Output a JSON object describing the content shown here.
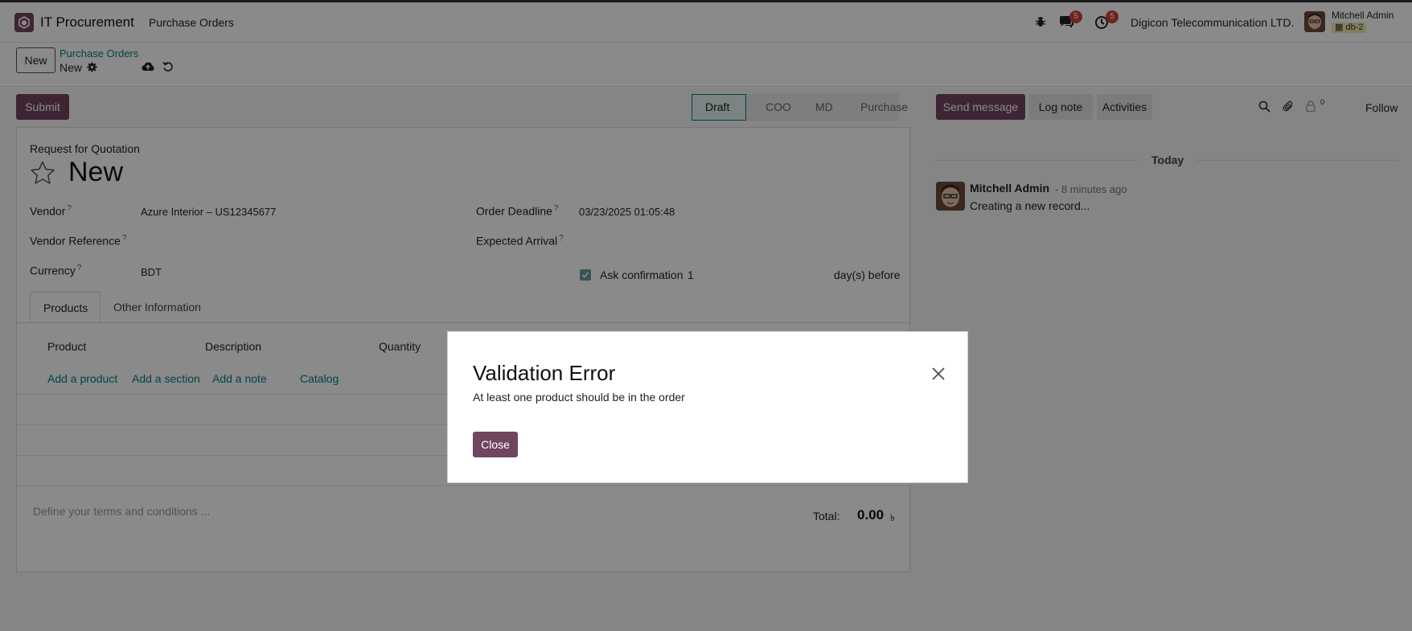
{
  "navbar": {
    "app_name": "IT Procurement",
    "menu": "Purchase Orders",
    "chat_badge": "5",
    "activity_badge": "5",
    "company": "Digicon Telecommunication LTD.",
    "user_name": "Mitchell Admin",
    "db_name": "db-2"
  },
  "control": {
    "new_label": "New",
    "breadcrumb_parent": "Purchase Orders",
    "breadcrumb_current": "New"
  },
  "form": {
    "submit_label": "Submit",
    "stages": [
      "Draft",
      "COO",
      "MD",
      "Purchase"
    ],
    "active_stage": "Draft",
    "subtitle": "Request for Quotation",
    "title": "New",
    "vendor_label": "Vendor",
    "vendor_value": "Azure Interior – US12345677",
    "vendor_ref_label": "Vendor Reference",
    "currency_label": "Currency",
    "currency_value": "BDT",
    "order_deadline_label": "Order Deadline",
    "order_deadline_value": "03/23/2025 01:05:48",
    "expected_arrival_label": "Expected Arrival",
    "ask_confirmation_label": "Ask confirmation",
    "ask_confirmation_days": "1",
    "ask_confirmation_suffix": "day(s) before",
    "ask_confirmation_checked": true,
    "tooltip_mark": "?",
    "tabs": [
      "Products",
      "Other Information"
    ],
    "columns": [
      "Product",
      "Description",
      "Quantity"
    ],
    "add_links": [
      "Add a product",
      "Add a section",
      "Add a note",
      "Catalog"
    ],
    "terms_placeholder": "Define your terms and conditions ...",
    "total_label": "Total:",
    "total_value": "0.00",
    "currency_symbol": "৳"
  },
  "chatter": {
    "send_message": "Send message",
    "log_note": "Log note",
    "activities": "Activities",
    "follower_count": "0",
    "follow": "Follow",
    "day_separator": "Today",
    "message": {
      "author": "Mitchell Admin",
      "time": "- 8 minutes ago",
      "body": "Creating a new record..."
    }
  },
  "dialog": {
    "title": "Validation Error",
    "body": "At least one product should be in the order",
    "close_label": "Close"
  },
  "colors": {
    "brand": "#71455f",
    "link": "#017e84",
    "badge": "#d23f3a"
  }
}
